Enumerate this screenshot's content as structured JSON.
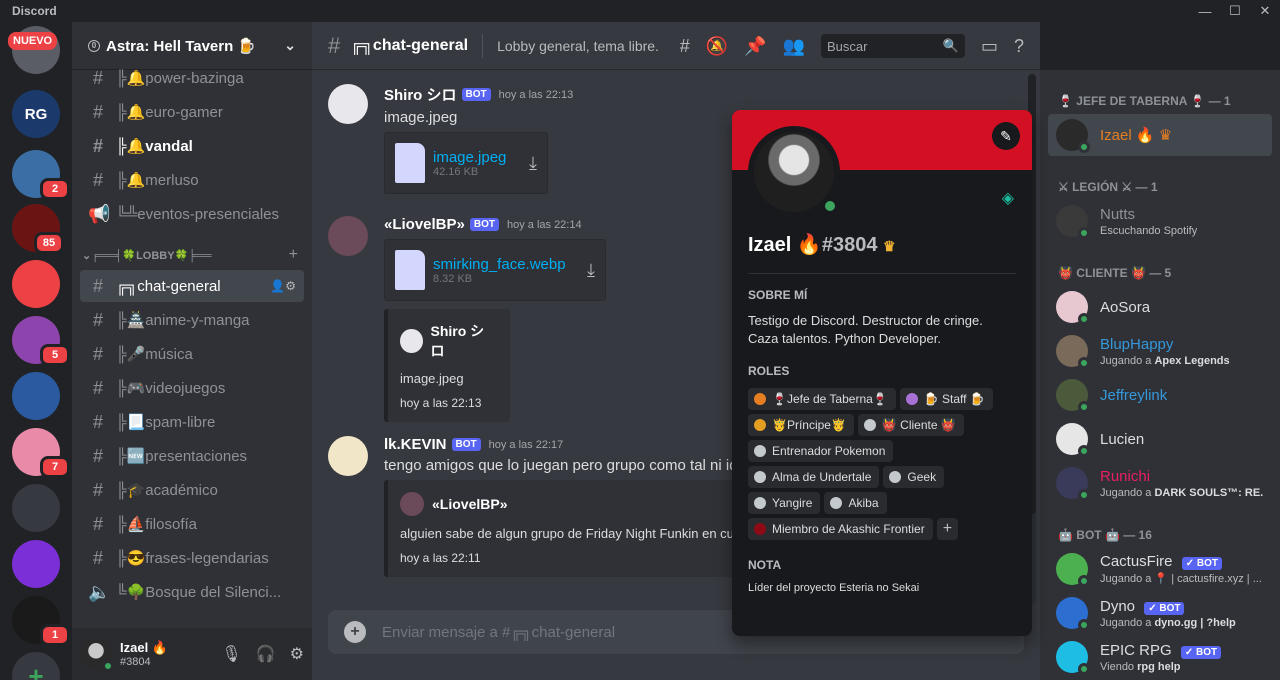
{
  "window": {
    "app_name": "Discord",
    "minimize": "—",
    "maximize": "☐",
    "close": "✕"
  },
  "rail": {
    "nuevo": "NUEVO",
    "badges": [
      "2",
      "85",
      "5",
      "7",
      "1"
    ],
    "rg_label": "RG"
  },
  "server": {
    "name": "Astra: Hell Tavern 🍺",
    "chevron": "⌄"
  },
  "channels": [
    {
      "label": "╠🔔power-bazinga",
      "type": "text",
      "bold": false
    },
    {
      "label": "╠🔔euro-gamer",
      "type": "text",
      "bold": false
    },
    {
      "label": "╠🔔vandal",
      "type": "text",
      "bold": true
    },
    {
      "label": "╠🔔merluso",
      "type": "text",
      "bold": false
    },
    {
      "label": "╚╩eventos-presenciales",
      "type": "stage",
      "bold": false
    }
  ],
  "lobby_category": "╒══╡🍀LOBBY🍀╞══",
  "lobby_channels": [
    {
      "label": "╔╗chat-general",
      "type": "text",
      "active": true
    },
    {
      "label": "╠🏯anime-y-manga",
      "type": "text"
    },
    {
      "label": "╠🎤música",
      "type": "text"
    },
    {
      "label": "╠🎮videojuegos",
      "type": "text"
    },
    {
      "label": "╠📃spam-libre",
      "type": "text"
    },
    {
      "label": "╠🆕presentaciones",
      "type": "text"
    },
    {
      "label": "╠🎓académico",
      "type": "text"
    },
    {
      "label": "╠⛵filosofía",
      "type": "text"
    },
    {
      "label": "╠😎frases-legendarias",
      "type": "text"
    },
    {
      "label": "╚🌳Bosque del Silenci...",
      "type": "voice"
    }
  ],
  "userbar": {
    "name": "Izael 🔥",
    "tag": "#3804"
  },
  "header": {
    "channel": "╔╗chat-general",
    "topic": "Lobby general, tema libre.",
    "search_placeholder": "Buscar"
  },
  "messages": [
    {
      "author": "Shiro シロ",
      "bot": "BOT",
      "time": "hoy a las 22:13",
      "text": "image.jpeg",
      "file": {
        "name": "image.jpeg",
        "size": "42.16 KB"
      }
    },
    {
      "author": "«LiovelBP»",
      "bot": "BOT",
      "time": "hoy a las 22:14",
      "file": {
        "name": "smirking_face.webp",
        "size": "8.32 KB"
      },
      "embed": {
        "author": "Shiro シロ",
        "text": "image.jpeg",
        "time": "hoy a las 22:13"
      }
    },
    {
      "author": "lk.KEVIN",
      "bot": "BOT",
      "time": "hoy a las 22:17",
      "text": "tengo amigos que lo juegan pero grupo como tal ni id",
      "embed": {
        "author": "«LiovelBP»",
        "text": "alguien sabe de algun grupo de Friday Night Funkin en cub",
        "time": "hoy a las 22:11"
      }
    }
  ],
  "composer": {
    "placeholder": "Enviar mensaje a #╔╗chat-general"
  },
  "profile": {
    "name": "Izael 🔥",
    "tag": "#3804",
    "crown": "♛",
    "about_header": "SOBRE MÍ",
    "about": "Testigo de Discord. Destructor de cringe. Caza talentos. Python Developer.",
    "roles_header": "ROLES",
    "roles": [
      {
        "label": "🍷Jefe de Taberna🍷",
        "color": "#e67e22"
      },
      {
        "label": "🍺 Staff 🍺",
        "color": "#a970d6"
      },
      {
        "label": "🤴Príncipe🤴",
        "color": "#e39e22"
      },
      {
        "label": "👹 Cliente 👹",
        "color": "#c4c9ce"
      },
      {
        "label": "Entrenador Pokemon",
        "color": "#c4c9ce"
      },
      {
        "label": "Alma de Undertale",
        "color": "#c4c9ce"
      },
      {
        "label": "Geek",
        "color": "#c4c9ce"
      },
      {
        "label": "Yangire",
        "color": "#c4c9ce"
      },
      {
        "label": "Akiba",
        "color": "#c4c9ce"
      },
      {
        "label": "Miembro de Akashic Frontier",
        "color": "#8e0b16"
      }
    ],
    "add_role": "+",
    "note_header": "NOTA",
    "note": "Líder del proyecto Esteria no Sekai"
  },
  "members": {
    "groups": [
      {
        "title": "🍷 JEFE DE TABERNA 🍷 — 1",
        "items": [
          {
            "name": "Izael 🔥 ♛",
            "color": "#e67e22",
            "selected": true
          }
        ]
      },
      {
        "title": "⚔ LEGIÓN ⚔ — 1",
        "items": [
          {
            "name": "Nutts",
            "color": "#8e9297",
            "activity": "Escuchando Spotify",
            "act_bold": ""
          }
        ]
      },
      {
        "title": "👹 CLIENTE 👹 — 5",
        "items": [
          {
            "name": "AoSora",
            "color": "#dcddde"
          },
          {
            "name": "BlupHappy",
            "color": "#3498db",
            "activity": "Jugando a ",
            "act_bold": "Apex Legends"
          },
          {
            "name": "Jeffreylink",
            "color": "#3498db"
          },
          {
            "name": "Lucien",
            "color": "#dcddde"
          },
          {
            "name": "Runichi",
            "color": "#e91e63",
            "activity": "Jugando a ",
            "act_bold": "DARK SOULS™: RE..."
          }
        ]
      },
      {
        "title": "🤖 BOT 🤖 — 16",
        "items": [
          {
            "name": "CactusFire",
            "color": "#dcddde",
            "bot": "✓ BOT",
            "activity": "Jugando a 📍 | cactusfire.xyz | ...",
            "act_bold": ""
          },
          {
            "name": "Dyno",
            "color": "#dcddde",
            "bot": "✓ BOT",
            "activity": "Jugando a ",
            "act_bold": "dyno.gg | ?help"
          },
          {
            "name": "EPIC RPG",
            "color": "#dcddde",
            "bot": "✓ BOT",
            "activity": "Viendo ",
            "act_bold": "rpg help"
          }
        ]
      }
    ]
  }
}
